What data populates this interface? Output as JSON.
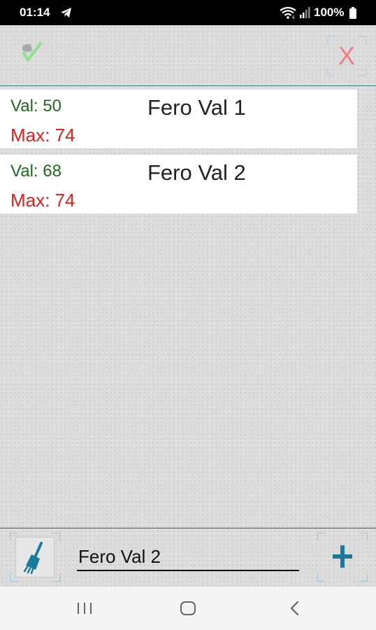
{
  "status_bar": {
    "time": "01:14",
    "battery": "100%",
    "icons": [
      "telegram-icon",
      "wifi-icon",
      "signal-icon",
      "battery-icon"
    ]
  },
  "toolbar": {
    "confirm_icon": "checkmark-icon",
    "close_label": "X",
    "close_color": "#f08080"
  },
  "items": [
    {
      "val": "Val: 50",
      "max": "Max: 74",
      "name": "Fero Val 1"
    },
    {
      "val": "Val: 68",
      "max": "Max: 74",
      "name": "Fero Val 2"
    }
  ],
  "input": {
    "value": "Fero Val 2",
    "clear_icon": "broom-icon",
    "add_icon": "plus-icon"
  },
  "colors": {
    "val_green": "#1e6a1e",
    "max_red": "#e02020",
    "accent_teal": "#1a7a9a"
  },
  "nav": {
    "icons": [
      "recent-apps-icon",
      "home-icon",
      "back-icon"
    ]
  }
}
